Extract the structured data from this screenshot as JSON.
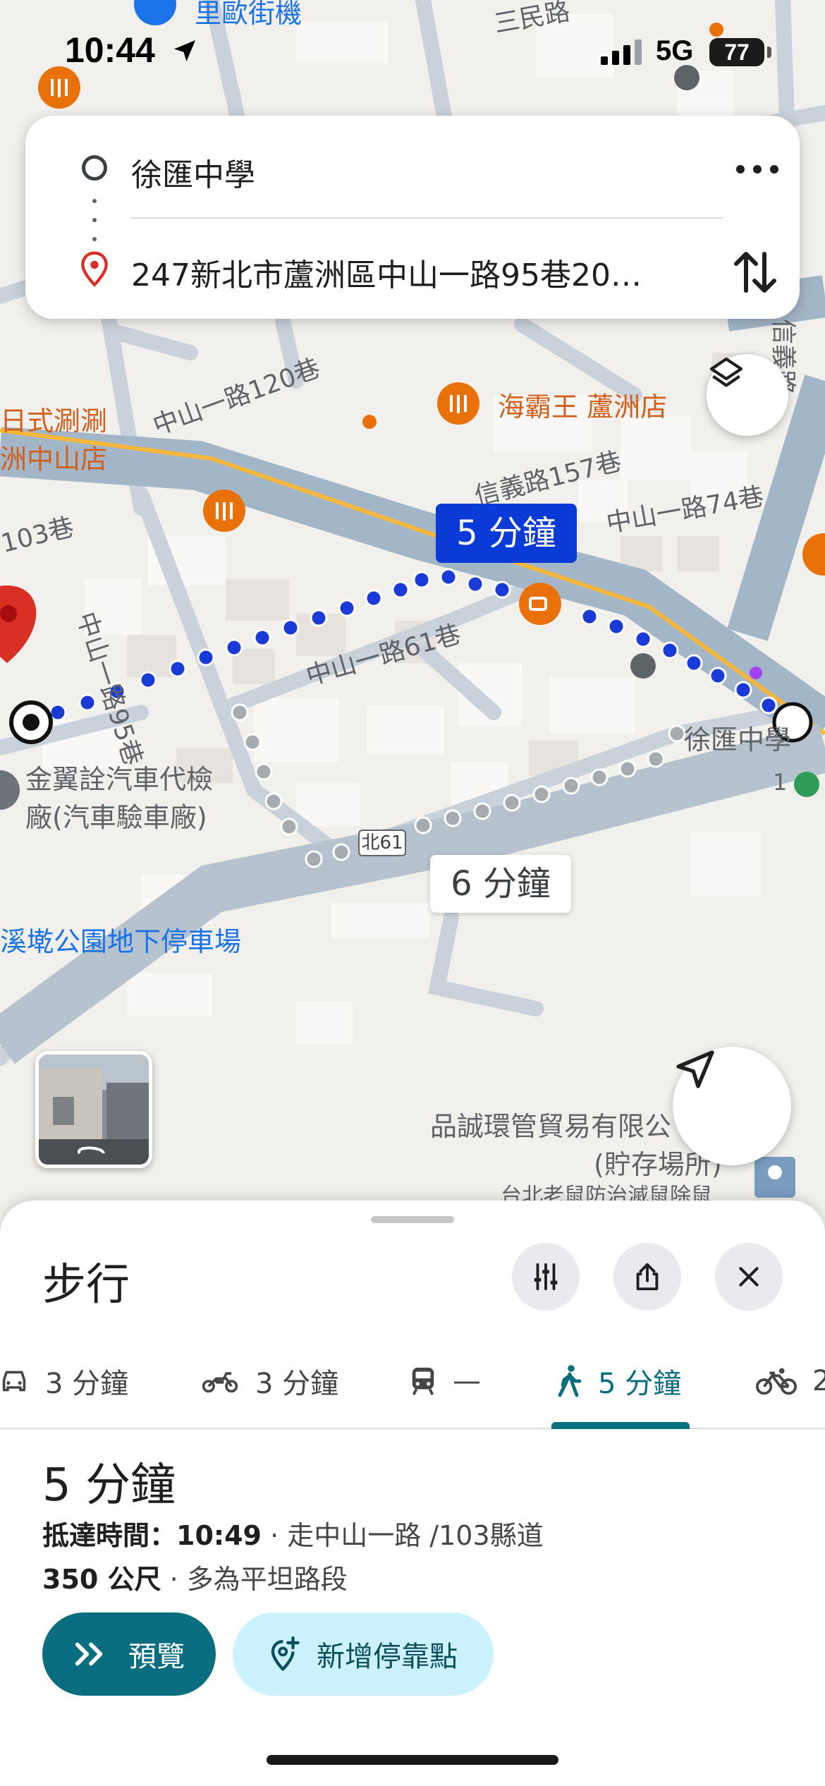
{
  "status_bar": {
    "time": "10:44",
    "network": "5G",
    "battery": "77"
  },
  "route": {
    "origin": "徐匯中學",
    "destination": "247新北市蘆洲區中山一路95巷20…"
  },
  "map": {
    "labels": {
      "top_poi": "里歐街機",
      "top_street": "三民路",
      "lane_120": "中山一路120巷",
      "restaurant": "海霸王 蘆洲店",
      "left_poi_line1": "日式涮涮",
      "left_poi_line2": "洲中山店",
      "lane_157": "信義路157巷",
      "lane_74": "中山一路74巷",
      "lane_103": "103巷",
      "lane_95": "中山一路95巷",
      "lane_61": "中山一路61巷",
      "xinyi": "信義路",
      "station": "徐匯中學",
      "exit_no": "1",
      "garage_line1": "金翼詮汽車代檢",
      "garage_line2": "廠(汽車驗車廠)",
      "park": "溪墘公園地下停車場",
      "company_line1": "品誠環管貿易有限公",
      "company_line2": "(貯存場所)",
      "pest": "台北老鼠防治滅鼠除鼠"
    },
    "road_shield": "北61",
    "callout_primary": "5 分鐘",
    "callout_alt": "6 分鐘"
  },
  "sheet": {
    "title": "步行",
    "tabs": [
      {
        "mode": "drive",
        "label": "3 分鐘",
        "icon": "car-icon"
      },
      {
        "mode": "motorcycle",
        "label": "3 分鐘",
        "icon": "motorcycle-icon"
      },
      {
        "mode": "transit",
        "label": "—",
        "icon": "train-icon"
      },
      {
        "mode": "walk",
        "label": "5 分鐘",
        "icon": "walk-icon",
        "selected": true
      },
      {
        "mode": "bike",
        "label": "2",
        "icon": "bike-icon"
      }
    ],
    "duration": "5 分鐘",
    "arrival_label": "抵達時間：",
    "arrival_time": "10:49",
    "via": " · 走中山一路 /103縣道",
    "distance": "350 公尺",
    "terrain": " · 多為平坦路段",
    "preview_label": "預覽",
    "add_stop_label": "新增停靠點"
  },
  "colors": {
    "accent": "#0b6e80",
    "route_blue": "#1a3bd8",
    "callout_blue": "#0b3bd6",
    "poi_orange": "#e8710a"
  }
}
